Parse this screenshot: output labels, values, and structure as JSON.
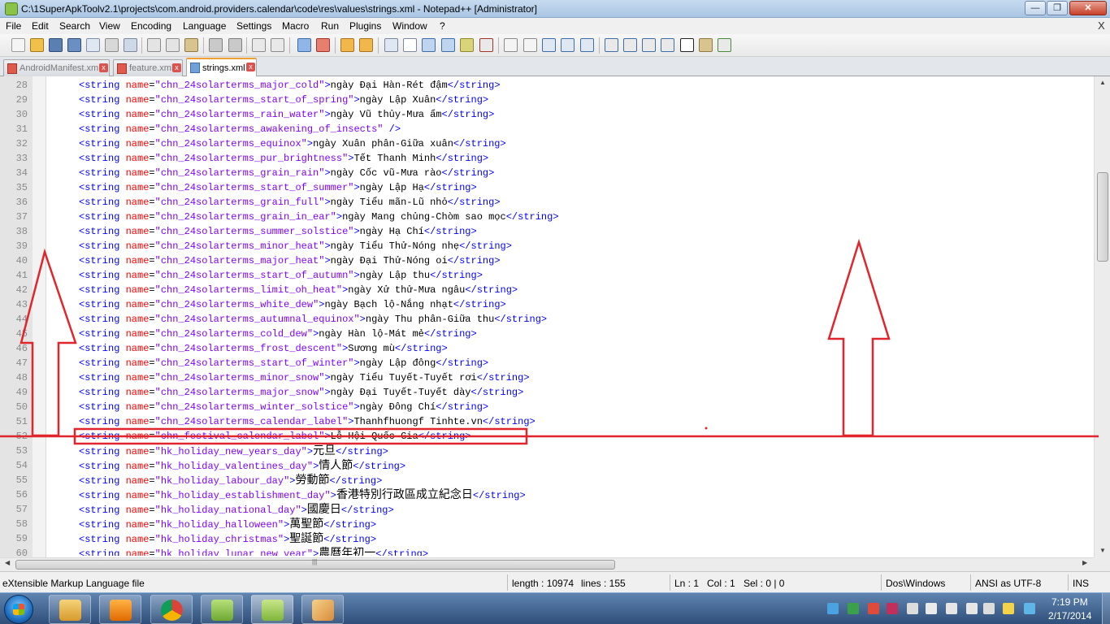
{
  "window": {
    "title": "C:\\1SuperApkToolv2.1\\projects\\com.android.providers.calendar\\code\\res\\values\\strings.xml - Notepad++ [Administrator]",
    "min_label": "—",
    "max_label": "❐",
    "close_label": "✕"
  },
  "menu": {
    "items": [
      "File",
      "Edit",
      "Search",
      "View",
      "Encoding",
      "Language",
      "Settings",
      "Macro",
      "Run",
      "Plugins",
      "Window",
      "?"
    ],
    "close_label": "X"
  },
  "tabs": [
    {
      "label": "AndroidManifest.xml",
      "active": false
    },
    {
      "label": "feature.xml",
      "active": false
    },
    {
      "label": "strings.xml",
      "active": true
    }
  ],
  "editor": {
    "lines": [
      {
        "num": "28",
        "name": "chn_24solarterms_major_cold",
        "value": "ngày Đại Hàn-Rét đậm",
        "cjk": false
      },
      {
        "num": "29",
        "name": "chn_24solarterms_start_of_spring",
        "value": "ngày Lập Xuân",
        "cjk": false
      },
      {
        "num": "30",
        "name": "chn_24solarterms_rain_water",
        "value": "ngày Vũ thủy-Mưa ẩm",
        "cjk": false
      },
      {
        "num": "31",
        "name": "chn_24solarterms_awakening_of_insects",
        "value": null,
        "cjk": false
      },
      {
        "num": "32",
        "name": "chn_24solarterms_equinox",
        "value": "ngày Xuân phân-Giữa xuân",
        "cjk": false
      },
      {
        "num": "33",
        "name": "chn_24solarterms_pur_brightness",
        "value": "Tết Thanh Minh",
        "cjk": false
      },
      {
        "num": "34",
        "name": "chn_24solarterms_grain_rain",
        "value": "ngày Cốc vũ-Mưa rào",
        "cjk": false
      },
      {
        "num": "35",
        "name": "chn_24solarterms_start_of_summer",
        "value": "ngày Lập Hạ",
        "cjk": false
      },
      {
        "num": "36",
        "name": "chn_24solarterms_grain_full",
        "value": "ngày Tiểu mãn-Lũ nhỏ",
        "cjk": false
      },
      {
        "num": "37",
        "name": "chn_24solarterms_grain_in_ear",
        "value": "ngày Mang chủng-Chòm sao mọc",
        "cjk": false
      },
      {
        "num": "38",
        "name": "chn_24solarterms_summer_solstice",
        "value": "ngày Hạ Chí",
        "cjk": false
      },
      {
        "num": "39",
        "name": "chn_24solarterms_minor_heat",
        "value": "ngày Tiểu Thử-Nóng nhẹ",
        "cjk": false
      },
      {
        "num": "40",
        "name": "chn_24solarterms_major_heat",
        "value": "ngày Đại Thử-Nóng oi",
        "cjk": false
      },
      {
        "num": "41",
        "name": "chn_24solarterms_start_of_autumn",
        "value": "ngày Lập thu",
        "cjk": false
      },
      {
        "num": "42",
        "name": "chn_24solarterms_limit_oh_heat",
        "value": "ngày Xử thử-Mưa ngâu",
        "cjk": false
      },
      {
        "num": "43",
        "name": "chn_24solarterms_white_dew",
        "value": "ngày Bạch lộ-Nắng nhạt",
        "cjk": false
      },
      {
        "num": "44",
        "name": "chn_24solarterms_autumnal_equinox",
        "value": "ngày Thu phân-Giữa thu",
        "cjk": false
      },
      {
        "num": "45",
        "name": "chn_24solarterms_cold_dew",
        "value": "ngày Hàn lộ-Mát mẻ",
        "cjk": false
      },
      {
        "num": "46",
        "name": "chn_24solarterms_frost_descent",
        "value": "Sương mù",
        "cjk": false
      },
      {
        "num": "47",
        "name": "chn_24solarterms_start_of_winter",
        "value": "ngày Lập đông",
        "cjk": false
      },
      {
        "num": "48",
        "name": "chn_24solarterms_minor_snow",
        "value": "ngày Tiểu Tuyết-Tuyết rơi",
        "cjk": false
      },
      {
        "num": "49",
        "name": "chn_24solarterms_major_snow",
        "value": "ngày Đại Tuyết-Tuyết dày",
        "cjk": false
      },
      {
        "num": "50",
        "name": "chn_24solarterms_winter_solstice",
        "value": "ngày Đông Chí",
        "cjk": false
      },
      {
        "num": "51",
        "name": "chn_24solarterms_calendar_label",
        "value": "Thanhfhuongf Tinhte.vn",
        "cjk": false
      },
      {
        "num": "52",
        "name": "chn_festival_calendar_label",
        "value": "Lễ Hội Quốc Gia",
        "cjk": false
      },
      {
        "num": "53",
        "name": "hk_holiday_new_years_day",
        "value": "元旦",
        "cjk": true
      },
      {
        "num": "54",
        "name": "hk_holiday_valentines_day",
        "value": "情人節",
        "cjk": true
      },
      {
        "num": "55",
        "name": "hk_holiday_labour_day",
        "value": "勞動節",
        "cjk": true
      },
      {
        "num": "56",
        "name": "hk_holiday_establishment_day",
        "value": "香港特別行政區成立紀念日",
        "cjk": true
      },
      {
        "num": "57",
        "name": "hk_holiday_national_day",
        "value": "國慶日",
        "cjk": true
      },
      {
        "num": "58",
        "name": "hk_holiday_halloween",
        "value": "萬聖節",
        "cjk": true
      },
      {
        "num": "59",
        "name": "hk_holiday_christmas",
        "value": "聖誕節",
        "cjk": true
      },
      {
        "num": "60",
        "name": "hk_holiday_lunar_new_year",
        "value": "農曆年初一",
        "cjk": true
      }
    ]
  },
  "statusbar": {
    "filetype": "eXtensible Markup Language file",
    "length": "length : 10974",
    "lines": "lines : 155",
    "ln": "Ln : 1",
    "col": "Col : 1",
    "sel": "Sel : 0 | 0",
    "eol": "Dos\\Windows",
    "encoding": "ANSI as UTF-8",
    "mode": "INS"
  },
  "taskbar": {
    "apps": [
      "file-explorer",
      "media-player",
      "chrome",
      "android-tool",
      "notepad-plus-plus",
      "paint"
    ],
    "time": "7:19 PM",
    "date": "2/17/2014"
  },
  "colors": {
    "tag": "#0000ff",
    "attr": "#ff0000",
    "value": "#8000ff",
    "annotation": "#e0262c"
  }
}
